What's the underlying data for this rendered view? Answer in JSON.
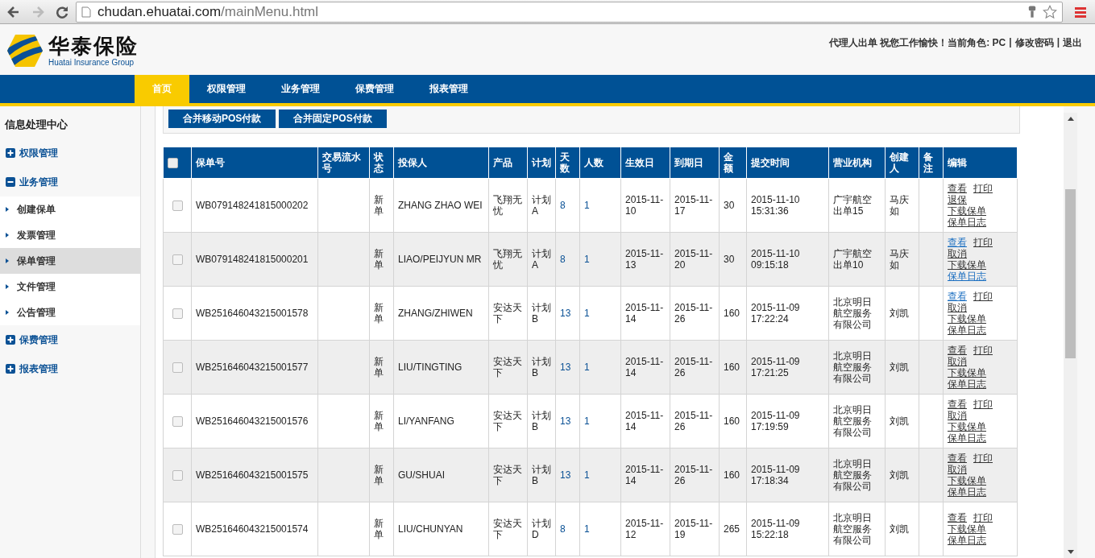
{
  "browser": {
    "url_host": "chudan.ehuatai.com",
    "url_path": "/mainMenu.html",
    "forward_disabled": true
  },
  "header": {
    "logo_name": "华泰保险",
    "logo_subtitle": "Huatai Insurance Group",
    "greeting": "代理人出单 祝您工作愉快！当前角色: PC",
    "links": [
      {
        "separator": "|",
        "label": "修改密码"
      },
      {
        "separator": "|",
        "label": "退出"
      }
    ]
  },
  "nav": [
    {
      "label": "首页",
      "selected": true
    },
    {
      "label": "权限管理",
      "selected": false
    },
    {
      "label": "业务管理",
      "selected": false
    },
    {
      "label": "保费管理",
      "selected": false
    },
    {
      "label": "报表管理",
      "selected": false
    }
  ],
  "sidebar": {
    "title": "信息处理中心",
    "groups": [
      {
        "label": "权限管理",
        "expanded": false
      },
      {
        "label": "业务管理",
        "expanded": true,
        "children": [
          {
            "label": "创建保单",
            "selected": false
          },
          {
            "label": "发票管理",
            "selected": false
          },
          {
            "label": "保单管理",
            "selected": true
          },
          {
            "label": "文件管理",
            "selected": false
          },
          {
            "label": "公告管理",
            "selected": false
          }
        ]
      },
      {
        "label": "保费管理",
        "expanded": false
      },
      {
        "label": "报表管理",
        "expanded": false
      }
    ]
  },
  "toolbar": {
    "buttons": [
      "合并移动POS付款",
      "合并固定POS付款"
    ]
  },
  "table": {
    "select_all_checked": false,
    "columns": [
      "保单号",
      "交易流水号",
      "状态",
      "投保人",
      "产品",
      "计划",
      "天数",
      "人数",
      "生效日",
      "到期日",
      "金额",
      "提交时间",
      "营业机构",
      "创建人",
      "备注",
      "编辑"
    ],
    "rows": [
      {
        "checked": false,
        "policy_no": "WB079148241815000202",
        "status": "新单",
        "insured": "ZHANG ZHAO WEI",
        "product": "飞翔无忧",
        "plan": "计划A",
        "days": "8",
        "persons": "1",
        "start": "2015-11-10",
        "end": "2015-11-17",
        "amount": "30",
        "submitted": "2015-11-10 15:31:36",
        "branch": "广宇航空出单15",
        "creator": "马庆如",
        "actions": [
          {
            "label": "查看",
            "visited": false
          },
          {
            "label": "打印",
            "visited": false
          },
          {
            "label": "退保",
            "visited": false
          },
          {
            "label": "下载保单",
            "visited": false
          },
          {
            "label": "保单日志",
            "visited": false
          }
        ]
      },
      {
        "checked": false,
        "policy_no": "WB079148241815000201",
        "status": "新单",
        "insured": "LIAO/PEIJYUN MR",
        "product": "飞翔无忧",
        "plan": "计划A",
        "days": "8",
        "persons": "1",
        "start": "2015-11-13",
        "end": "2015-11-20",
        "amount": "30",
        "submitted": "2015-11-10 09:15:18",
        "branch": "广宇航空出单10",
        "creator": "马庆如",
        "actions": [
          {
            "label": "查看",
            "visited": true
          },
          {
            "label": "打印",
            "visited": false
          },
          {
            "label": "取消",
            "visited": false
          },
          {
            "label": "下载保单",
            "visited": false
          },
          {
            "label": "保单日志",
            "visited": true
          }
        ]
      },
      {
        "checked": false,
        "policy_no": "WB251646043215001578",
        "status": "新单",
        "insured": "ZHANG/ZHIWEN",
        "product": "安达天下",
        "plan": "计划B",
        "days": "13",
        "persons": "1",
        "start": "2015-11-14",
        "end": "2015-11-26",
        "amount": "160",
        "submitted": "2015-11-09 17:22:24",
        "branch": "北京明日航空服务有限公司",
        "creator": "刘凯",
        "actions": [
          {
            "label": "查看",
            "visited": true
          },
          {
            "label": "打印",
            "visited": false
          },
          {
            "label": "取消",
            "visited": false
          },
          {
            "label": "下载保单",
            "visited": false
          },
          {
            "label": "保单日志",
            "visited": false
          }
        ]
      },
      {
        "checked": false,
        "policy_no": "WB251646043215001577",
        "status": "新单",
        "insured": "LIU/TINGTING",
        "product": "安达天下",
        "plan": "计划B",
        "days": "13",
        "persons": "1",
        "start": "2015-11-14",
        "end": "2015-11-26",
        "amount": "160",
        "submitted": "2015-11-09 17:21:25",
        "branch": "北京明日航空服务有限公司",
        "creator": "刘凯",
        "actions": [
          {
            "label": "查看",
            "visited": false
          },
          {
            "label": "打印",
            "visited": false
          },
          {
            "label": "取消",
            "visited": false
          },
          {
            "label": "下载保单",
            "visited": false
          },
          {
            "label": "保单日志",
            "visited": false
          }
        ]
      },
      {
        "checked": false,
        "policy_no": "WB251646043215001576",
        "status": "新单",
        "insured": "LI/YANFANG",
        "product": "安达天下",
        "plan": "计划B",
        "days": "13",
        "persons": "1",
        "start": "2015-11-14",
        "end": "2015-11-26",
        "amount": "160",
        "submitted": "2015-11-09 17:19:59",
        "branch": "北京明日航空服务有限公司",
        "creator": "刘凯",
        "actions": [
          {
            "label": "查看",
            "visited": false
          },
          {
            "label": "打印",
            "visited": false
          },
          {
            "label": "取消",
            "visited": false
          },
          {
            "label": "下载保单",
            "visited": false
          },
          {
            "label": "保单日志",
            "visited": false
          }
        ]
      },
      {
        "checked": false,
        "policy_no": "WB251646043215001575",
        "status": "新单",
        "insured": "GU/SHUAI",
        "product": "安达天下",
        "plan": "计划B",
        "days": "13",
        "persons": "1",
        "start": "2015-11-14",
        "end": "2015-11-26",
        "amount": "160",
        "submitted": "2015-11-09 17:18:34",
        "branch": "北京明日航空服务有限公司",
        "creator": "刘凯",
        "actions": [
          {
            "label": "查看",
            "visited": false
          },
          {
            "label": "打印",
            "visited": false
          },
          {
            "label": "取消",
            "visited": false
          },
          {
            "label": "下载保单",
            "visited": false
          },
          {
            "label": "保单日志",
            "visited": false
          }
        ]
      },
      {
        "checked": false,
        "policy_no": "WB251646043215001574",
        "status": "新单",
        "insured": "LIU/CHUNYAN",
        "product": "安达天下",
        "plan": "计划D",
        "days": "8",
        "persons": "1",
        "start": "2015-11-12",
        "end": "2015-11-19",
        "amount": "265",
        "submitted": "2015-11-09 15:22:18",
        "branch": "北京明日航空服务有限公司",
        "creator": "刘凯",
        "actions": [
          {
            "label": "查看",
            "visited": false
          },
          {
            "label": "打印",
            "visited": false
          },
          {
            "label": "下载保单",
            "visited": false
          },
          {
            "label": "保单日志",
            "visited": false
          }
        ]
      }
    ]
  }
}
